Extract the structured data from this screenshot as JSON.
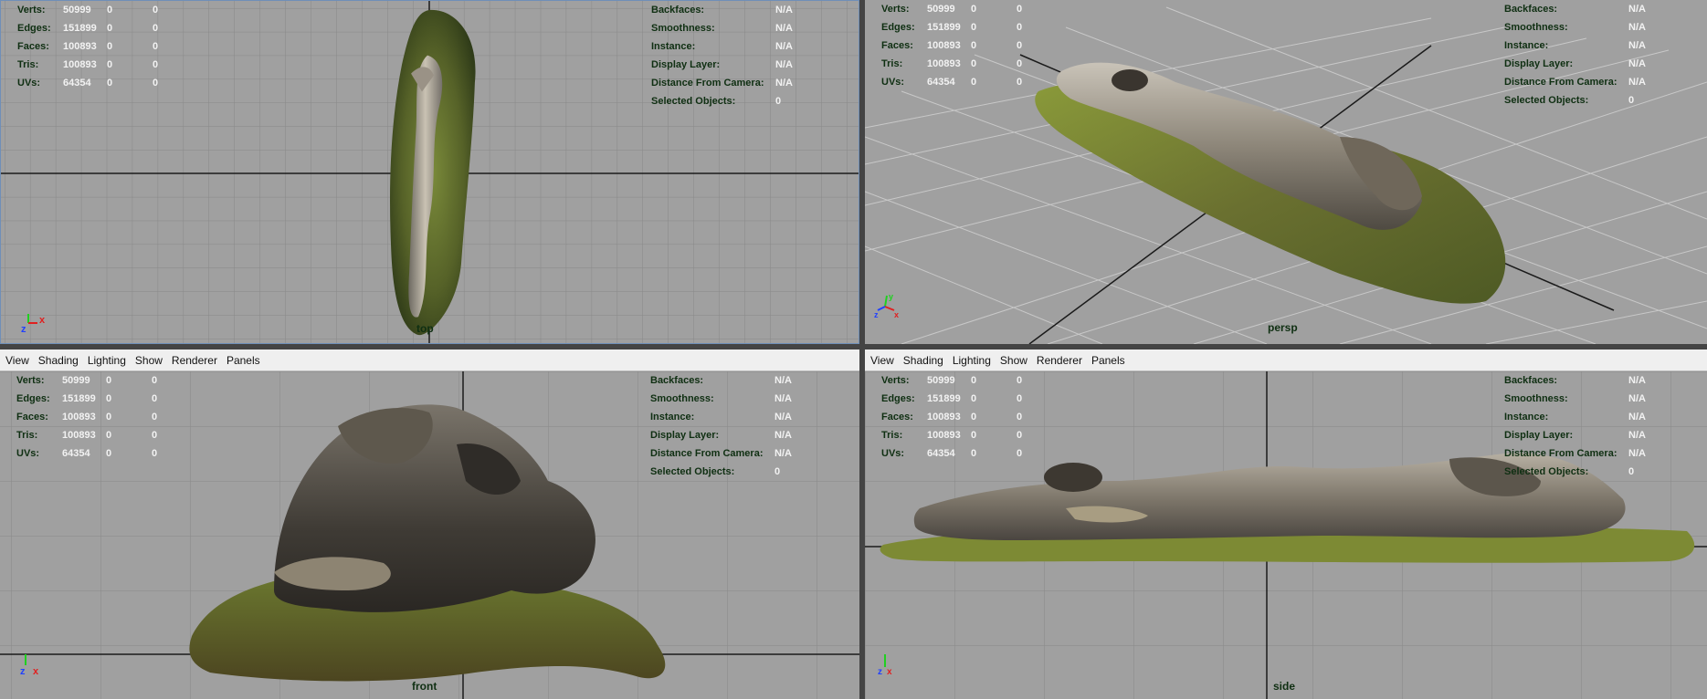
{
  "menu": [
    "View",
    "Shading",
    "Lighting",
    "Show",
    "Renderer",
    "Panels"
  ],
  "stats": [
    {
      "label": "Verts:",
      "v1": "50999",
      "v2": "0",
      "v3": "0"
    },
    {
      "label": "Edges:",
      "v1": "151899",
      "v2": "0",
      "v3": "0"
    },
    {
      "label": "Faces:",
      "v1": "100893",
      "v2": "0",
      "v3": "0"
    },
    {
      "label": "Tris:",
      "v1": "100893",
      "v2": "0",
      "v3": "0"
    },
    {
      "label": "UVs:",
      "v1": "64354",
      "v2": "0",
      "v3": "0"
    }
  ],
  "info": [
    {
      "label": "Backfaces:",
      "value": "N/A"
    },
    {
      "label": "Smoothness:",
      "value": "N/A"
    },
    {
      "label": "Instance:",
      "value": "N/A"
    },
    {
      "label": "Display Layer:",
      "value": "N/A"
    },
    {
      "label": "Distance From Camera:",
      "value": "N/A"
    },
    {
      "label": "Selected Objects:",
      "value": "0"
    }
  ],
  "views": {
    "top": {
      "camera": "top",
      "axes": [
        "y",
        "x",
        "z"
      ]
    },
    "persp": {
      "camera": "persp",
      "axes": [
        "y",
        "x",
        "z"
      ]
    },
    "front": {
      "camera": "front",
      "axes": [
        "y",
        "z",
        "x"
      ]
    },
    "side": {
      "camera": "side",
      "axes": [
        "y",
        "z",
        "x"
      ]
    }
  },
  "colors": {
    "viewport_bg": "#a0a0a0",
    "grid": "#8a8a8a",
    "grid_axis": "#1a1a1a",
    "hud_label": "#0f2f12",
    "hud_value": "#f2f2f2",
    "active_border": "#6f8fb8",
    "axis_x": "#e02020",
    "axis_y": "#20d020",
    "axis_z": "#2040ff"
  }
}
